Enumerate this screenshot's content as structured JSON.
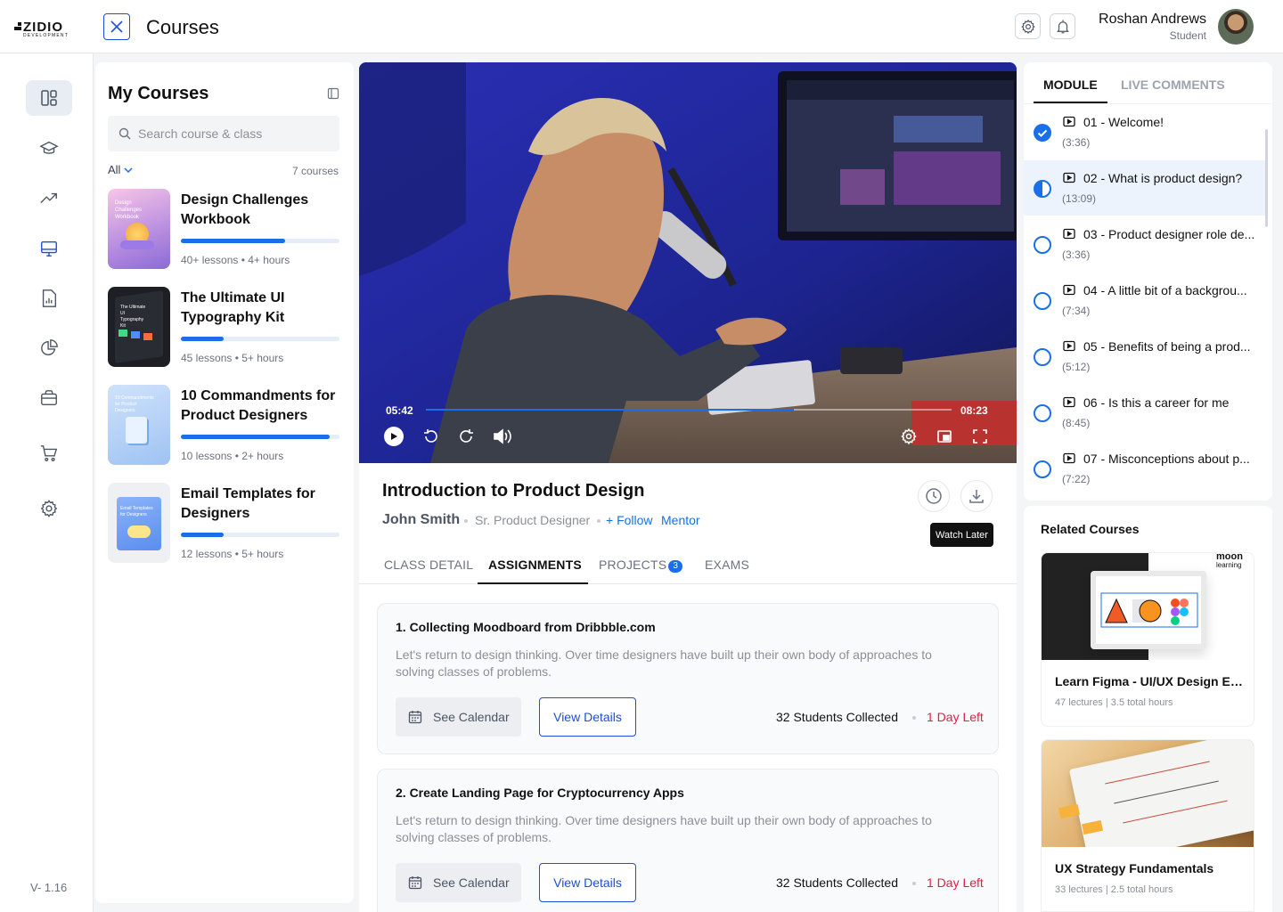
{
  "brand": {
    "name": "ZIDIO",
    "sub": "DEVELOPMENT"
  },
  "header": {
    "title": "Courses",
    "user_name": "Roshan Andrews",
    "user_role": "Student"
  },
  "sidebar": {
    "icons": [
      "dashboard-icon",
      "graduation-cap-icon",
      "trending-icon",
      "monitor-icon",
      "report-icon",
      "pie-chart-icon",
      "briefcase-icon",
      "cart-icon",
      "settings-icon"
    ],
    "version": "V- 1.16"
  },
  "my_courses": {
    "title": "My Courses",
    "search_placeholder": "Search course & class",
    "filter": "All",
    "count": "7 courses",
    "items": [
      {
        "title": "Design Challenges Workbook",
        "progress": 0.66,
        "meta": "40+ lessons • 4+ hours"
      },
      {
        "title": "The Ultimate UI Typography Kit",
        "progress": 0.27,
        "meta": "45 lessons • 5+ hours"
      },
      {
        "title": "10 Commandments for Product Designers",
        "progress": 0.94,
        "meta": "10 lessons • 2+ hours"
      },
      {
        "title": "Email Templates for Designers",
        "progress": 0.27,
        "meta": "12 lessons • 5+ hours"
      }
    ]
  },
  "player": {
    "current": "05:42",
    "duration": "08:23",
    "progress": 0.7
  },
  "lesson": {
    "title": "Introduction to Product Design",
    "author": "John Smith",
    "author_role": "Sr. Product Designer",
    "follow": "+ Follow",
    "mentor": "Mentor",
    "tooltip": "Watch Later",
    "tabs": [
      "CLASS DETAIL",
      "ASSIGNMENTS",
      "PROJECTS",
      "EXAMS"
    ],
    "projects_badge": "3"
  },
  "assignments": [
    {
      "title": "1. Collecting Moodboard from Dribbble.com",
      "desc": "Let's return to design thinking. Over time designers have built up their own body of approaches to solving classes of problems.",
      "calendar": "See Calendar",
      "details": "View Details",
      "collected": "32 Students Collected",
      "left": "1 Day Left"
    },
    {
      "title": "2. Create Landing Page for Cryptocurrency Apps",
      "desc": "Let's return to design thinking. Over time designers have built up their own body of approaches to solving classes of problems.",
      "calendar": "See Calendar",
      "details": "View Details",
      "collected": "32 Students Collected",
      "left": "1 Day Left"
    }
  ],
  "module": {
    "tabs": [
      "MODULE",
      "LIVE COMMENTS"
    ],
    "items": [
      {
        "title": "01 - Welcome!",
        "duration": "(3:36)",
        "status": "done"
      },
      {
        "title": "02 - What is product design?",
        "duration": "(13:09)",
        "status": "half"
      },
      {
        "title": "03 - Product designer role de...",
        "duration": "(3:36)",
        "status": "todo"
      },
      {
        "title": "04 - A little bit of a backgrou...",
        "duration": "(7:34)",
        "status": "todo"
      },
      {
        "title": "05 - Benefits of being a prod...",
        "duration": "(5:12)",
        "status": "todo"
      },
      {
        "title": "06 - Is this a career for me",
        "duration": "(8:45)",
        "status": "todo"
      },
      {
        "title": "07 - Misconceptions about p...",
        "duration": "(7:22)",
        "status": "todo"
      }
    ]
  },
  "related": {
    "title": "Related Courses",
    "items": [
      {
        "title": "Learn Figma - UI/UX Design Es...",
        "meta": "47 lectures | 3.5 total hours",
        "logo": "moon",
        "logo_sub": "learning"
      },
      {
        "title": "UX Strategy Fundamentals",
        "meta": "33 lectures | 2.5 total hours"
      }
    ]
  },
  "colors": {
    "accent": "#1a6fe8",
    "danger": "#e11d48"
  }
}
